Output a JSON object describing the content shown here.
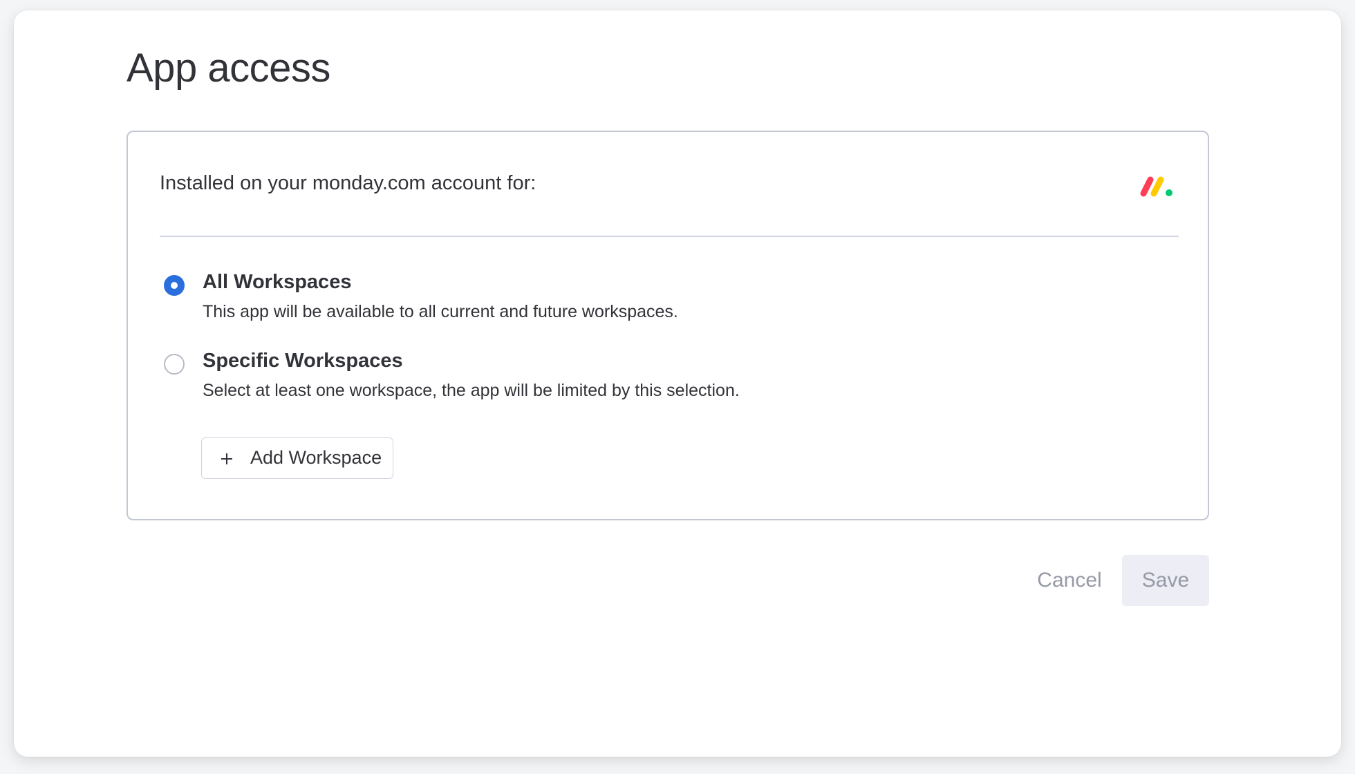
{
  "page": {
    "title": "App access"
  },
  "card": {
    "header_text": "Installed on your monday.com account for:",
    "brand_icon": "monday-logo-icon",
    "brand_colors": [
      "#ff3d57",
      "#ffcb00",
      "#00ca72"
    ]
  },
  "options": [
    {
      "title": "All Workspaces",
      "description": "This app will be available to all current and future workspaces.",
      "selected": true
    },
    {
      "title": "Specific Workspaces",
      "description": "Select at least one workspace, the app will be limited by this selection.",
      "selected": false
    }
  ],
  "add_workspace": {
    "label": "Add Workspace",
    "icon": "plus-icon"
  },
  "footer": {
    "cancel_label": "Cancel",
    "save_label": "Save",
    "save_disabled": true
  },
  "colors": {
    "accent": "#2b6fde",
    "text_primary": "#323338",
    "text_disabled": "#9699a6",
    "border": "#c3c6d4",
    "save_bg_disabled": "#ecedf5"
  }
}
